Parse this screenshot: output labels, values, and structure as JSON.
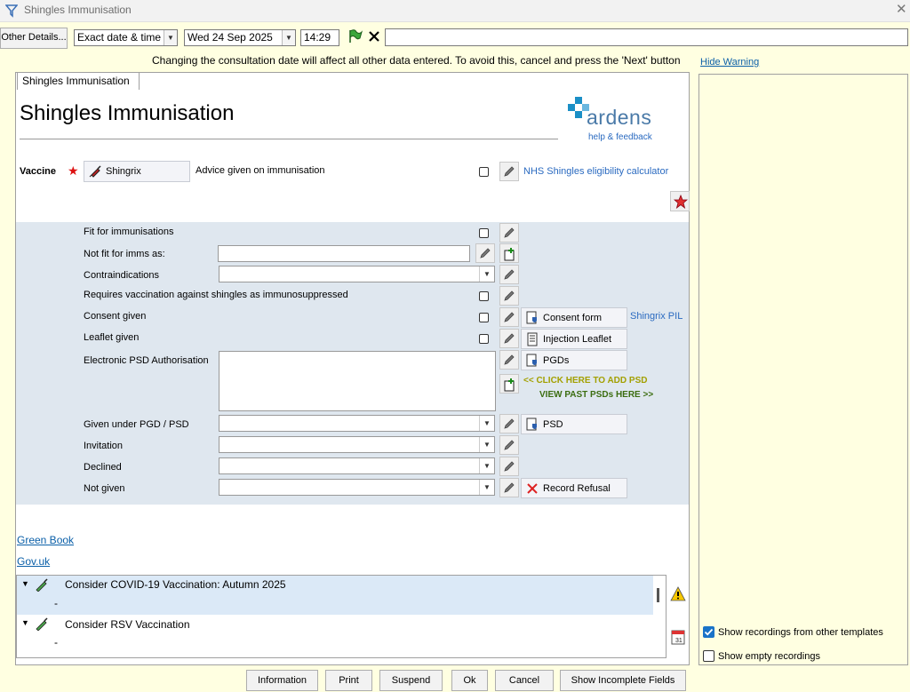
{
  "window": {
    "title": "Shingles Immunisation"
  },
  "toolbar": {
    "other_details": "Other Details...",
    "date_mode": "Exact date & time",
    "date": "Wed 24 Sep 2025",
    "time": "14:29",
    "free_text_value": ""
  },
  "warning": {
    "text": "Changing the consultation date will affect all other data entered. To avoid this, cancel and press the 'Next' button",
    "hide_link": "Hide Warning"
  },
  "tab": {
    "label": "Shingles Immunisation"
  },
  "page": {
    "heading": "Shingles Immunisation"
  },
  "brand": {
    "logo_text": "ardens",
    "help_link": "help & feedback",
    "accent": "#1b8fc6"
  },
  "vaccine": {
    "label": "Vaccine",
    "selected": "Shingrix",
    "advice_label": "Advice given on immunisation",
    "calculator_link": "NHS Shingles eligibility calculator"
  },
  "form": {
    "fit": "Fit for immunisations",
    "not_fit": "Not fit for imms as:",
    "contraindications": "Contraindications",
    "requires": "Requires vaccination against shingles as immunosuppressed",
    "consent": "Consent given",
    "leaflet": "Leaflet given",
    "psd_auth": "Electronic PSD Authorisation",
    "given_under": "Given under PGD / PSD",
    "invitation": "Invitation",
    "declined": "Declined",
    "not_given": "Not given"
  },
  "actions": {
    "consent_form": "Consent form",
    "shingrix_pil": "Shingrix PIL",
    "injection_leaflet": "Injection Leaflet",
    "pgds": "PGDs",
    "add_psd": "<< CLICK HERE TO ADD PSD",
    "view_psds": "VIEW PAST PSDs HERE >>",
    "psd": "PSD",
    "record_refusal": "Record Refusal"
  },
  "links": {
    "green_book": "Green Book",
    "gov_uk": "Gov.uk"
  },
  "list": {
    "items": [
      {
        "title": "Consider COVID-19 Vaccination: Autumn 2025",
        "sub": "-"
      },
      {
        "title": "Consider RSV Vaccination",
        "sub": "-"
      }
    ]
  },
  "right_panel": {
    "show_other": "Show recordings from other templates",
    "show_other_checked": true,
    "show_empty": "Show empty recordings",
    "show_empty_checked": false
  },
  "bottom": {
    "information": "Information",
    "print": "Print",
    "suspend": "Suspend",
    "ok": "Ok",
    "cancel": "Cancel",
    "show_incomplete": "Show Incomplete Fields"
  }
}
